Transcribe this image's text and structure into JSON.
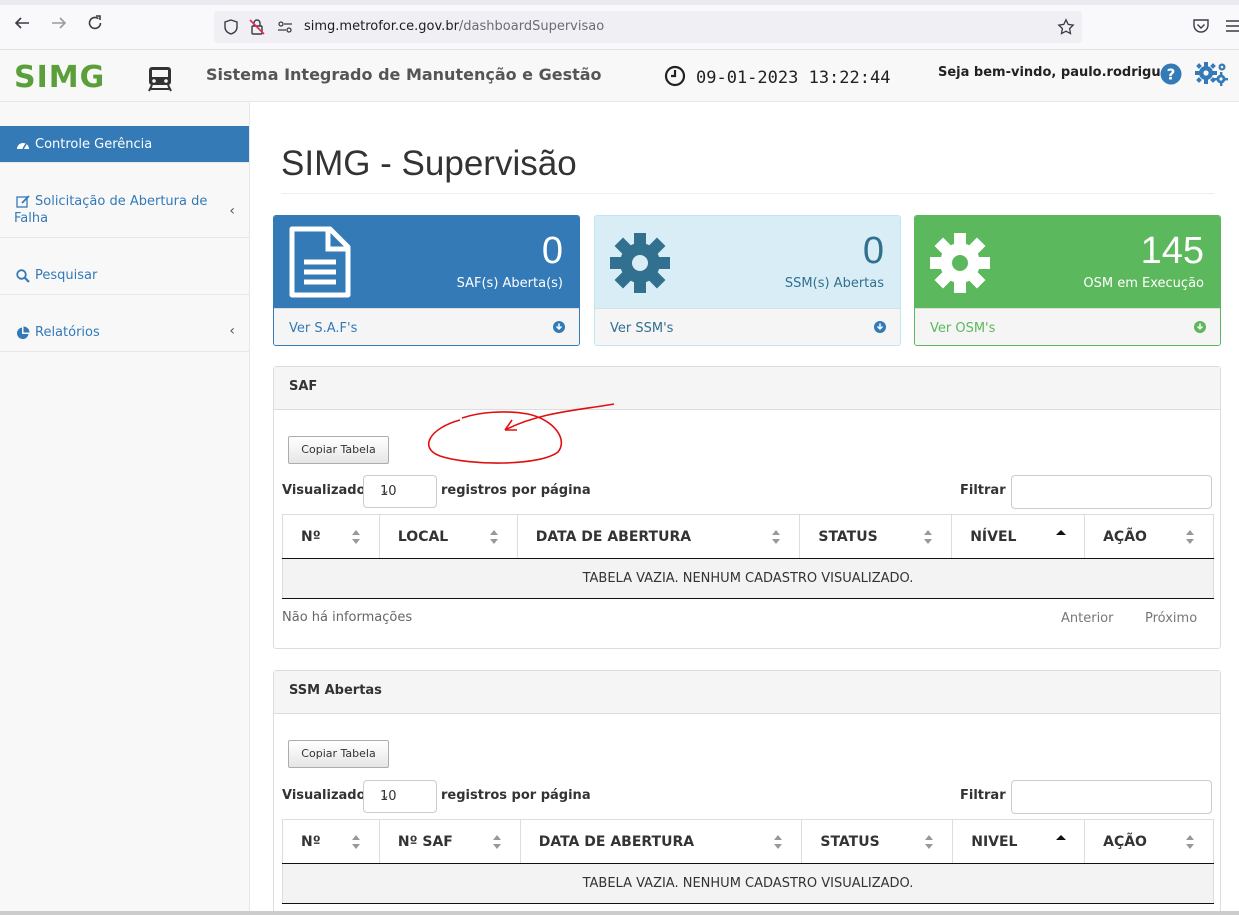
{
  "browser": {
    "url_host": "simg.metrofor.ce.gov.br",
    "url_path": "/dashboardSupervisao"
  },
  "header": {
    "logo": "SIMG",
    "title": "Sistema Integrado de Manutenção e Gestão",
    "datetime": "09-01-2023 13:22:44",
    "welcome": "Seja bem-vindo, paulo.rodrigues"
  },
  "sidebar": {
    "items": [
      {
        "label": "Controle Gerência",
        "icon": "dashboard-icon",
        "active": true
      },
      {
        "label": "Solicitação de Abertura de",
        "label2": "Falha",
        "icon": "edit-icon"
      },
      {
        "label": "Pesquisar",
        "icon": "search-icon"
      },
      {
        "label": "Relatórios",
        "icon": "pie-chart-icon"
      }
    ]
  },
  "main": {
    "title": "SIMG - Supervisão",
    "cards": [
      {
        "value": "0",
        "caption": "SAF(s) Aberta(s)",
        "link": "Ver S.A.F's",
        "color": "#337ab7"
      },
      {
        "value": "0",
        "caption": "SSM(s) Abertas",
        "link": "Ver SSM's",
        "color": "#d9edf7"
      },
      {
        "value": "145",
        "caption": "OSM em Execução",
        "link": "Ver OSM's",
        "color": "#5cb85c"
      }
    ]
  },
  "saf_panel": {
    "heading": "SAF",
    "copy_button": "Copiar Tabela",
    "show_label": "Visualizado",
    "page_size": "10",
    "per_page_label": "registros por página",
    "filter_label": "Filtrar",
    "columns": [
      "Nº",
      "LOCAL",
      "DATA DE ABERTURA",
      "STATUS",
      "NÍVEL",
      "AÇÃO"
    ],
    "empty_message": "TABELA VAZIA. NENHUM CADASTRO VISUALIZADO.",
    "info": "Não há informações",
    "prev": "Anterior",
    "next": "Próximo"
  },
  "ssm_panel": {
    "heading": "SSM Abertas",
    "copy_button": "Copiar Tabela",
    "show_label": "Visualizado",
    "page_size": "10",
    "per_page_label": "registros por página",
    "filter_label": "Filtrar",
    "columns": [
      "Nº",
      "Nº SAF",
      "DATA DE ABERTURA",
      "STATUS",
      "NIVEL",
      "AÇÃO"
    ],
    "empty_message": "TABELA VAZIA. NENHUM CADASTRO VISUALIZADO."
  }
}
